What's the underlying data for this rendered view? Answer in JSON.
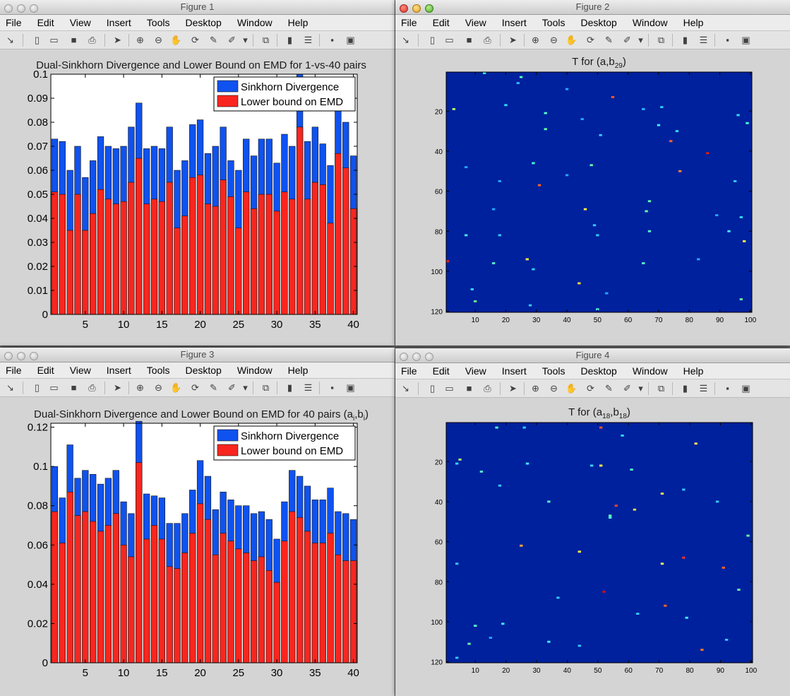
{
  "menu": [
    "File",
    "Edit",
    "View",
    "Insert",
    "Tools",
    "Desktop",
    "Window",
    "Help"
  ],
  "toolbar_icons": [
    {
      "name": "dock-arrow-icon",
      "glyph": "↘"
    },
    {
      "name": "new-figure-icon",
      "glyph": "▯"
    },
    {
      "name": "open-file-icon",
      "glyph": "▭"
    },
    {
      "name": "save-icon",
      "glyph": "■"
    },
    {
      "name": "print-icon",
      "glyph": "⎙"
    },
    {
      "name": "select-arrow-icon",
      "glyph": "➤"
    },
    {
      "name": "zoom-in-icon",
      "glyph": "⊕"
    },
    {
      "name": "zoom-out-icon",
      "glyph": "⊖"
    },
    {
      "name": "pan-hand-icon",
      "glyph": "✋"
    },
    {
      "name": "rotate-3d-icon",
      "glyph": "⟳"
    },
    {
      "name": "data-cursor-icon",
      "glyph": "✎"
    },
    {
      "name": "brush-icon",
      "glyph": "✐"
    },
    {
      "name": "brush-dropdown-icon",
      "glyph": "▾"
    },
    {
      "name": "link-plot-icon",
      "glyph": "⧉"
    },
    {
      "name": "colorbar-icon",
      "glyph": "▮"
    },
    {
      "name": "legend-icon",
      "glyph": "☰"
    },
    {
      "name": "hide-tools-icon",
      "glyph": "▪"
    },
    {
      "name": "show-tools-icon",
      "glyph": "▣"
    }
  ],
  "colors": {
    "sinkhorn": "#0f52ef",
    "emd": "#f8261f",
    "heat_bg": "#00219e",
    "plot_bg": "#ffffff"
  },
  "windows": [
    {
      "id": "figure1",
      "title": "Figure 1",
      "focused": false
    },
    {
      "id": "figure2",
      "title": "Figure 2",
      "focused": true
    },
    {
      "id": "figure3",
      "title": "Figure 3",
      "focused": false
    },
    {
      "id": "figure4",
      "title": "Figure 4",
      "focused": false
    }
  ],
  "chart_data": [
    {
      "figure": "Figure 1",
      "type": "bar",
      "stacked": true,
      "title": "Dual-Sinkhorn Divergence and Lower Bound on EMD for 1-vs-40 pairs",
      "xlim": [
        0.5,
        40.5
      ],
      "ylim": [
        0,
        0.1
      ],
      "xticks": [
        5,
        10,
        15,
        20,
        25,
        30,
        35,
        40
      ],
      "yticks": [
        0,
        0.01,
        0.02,
        0.03,
        0.04,
        0.05,
        0.06,
        0.07,
        0.08,
        0.09,
        0.1
      ],
      "ytick_labels": [
        "0",
        "0.01",
        "0.02",
        "0.03",
        "0.04",
        "0.05",
        "0.06",
        "0.07",
        "0.08",
        "0.09",
        "0.1"
      ],
      "legend": [
        "Sinkhorn Divergence",
        "Lower bound on EMD"
      ],
      "legend_position": "top-right",
      "series": [
        {
          "name": "Sinkhorn Divergence",
          "values": [
            0.073,
            0.072,
            0.06,
            0.07,
            0.057,
            0.064,
            0.074,
            0.07,
            0.069,
            0.07,
            0.078,
            0.088,
            0.069,
            0.07,
            0.069,
            0.078,
            0.06,
            0.064,
            0.079,
            0.081,
            0.067,
            0.07,
            0.078,
            0.064,
            0.06,
            0.073,
            0.066,
            0.073,
            0.073,
            0.063,
            0.075,
            0.07,
            0.1,
            0.072,
            0.078,
            0.071,
            0.062,
            0.089,
            0.08,
            0.066
          ]
        },
        {
          "name": "Lower bound on EMD",
          "values": [
            0.051,
            0.05,
            0.035,
            0.05,
            0.035,
            0.042,
            0.052,
            0.048,
            0.046,
            0.047,
            0.055,
            0.065,
            0.046,
            0.048,
            0.047,
            0.055,
            0.036,
            0.041,
            0.057,
            0.058,
            0.046,
            0.045,
            0.056,
            0.049,
            0.036,
            0.051,
            0.044,
            0.05,
            0.05,
            0.043,
            0.051,
            0.048,
            0.078,
            0.048,
            0.055,
            0.054,
            0.038,
            0.067,
            0.061,
            0.044
          ]
        }
      ]
    },
    {
      "figure": "Figure 2",
      "type": "heatmap",
      "title": "T for (a,b",
      "title_sub": "29",
      "title_end": ")",
      "xlim": [
        0.5,
        100.5
      ],
      "ylim": [
        0.5,
        120.5
      ],
      "xticks": [
        10,
        20,
        30,
        40,
        50,
        60,
        70,
        80,
        90,
        100
      ],
      "yticks": [
        20,
        40,
        60,
        80,
        100,
        120
      ],
      "points": [
        [
          13,
          1,
          "#3cffd0"
        ],
        [
          25,
          3,
          "#55ffb8"
        ],
        [
          24,
          6,
          "#33bbff"
        ],
        [
          40,
          9,
          "#22aaff"
        ],
        [
          55,
          13,
          "#ff5522"
        ],
        [
          3,
          19,
          "#aaff66"
        ],
        [
          20,
          17,
          "#33ddff"
        ],
        [
          33,
          21,
          "#55ffcc"
        ],
        [
          65,
          19,
          "#22bbff"
        ],
        [
          71,
          18,
          "#33ccff"
        ],
        [
          45,
          24,
          "#22aaff"
        ],
        [
          33,
          29,
          "#66ffaa"
        ],
        [
          51,
          32,
          "#33ccff"
        ],
        [
          70,
          27,
          "#44eeff"
        ],
        [
          76,
          30,
          "#33ddff"
        ],
        [
          96,
          22,
          "#33ddff"
        ],
        [
          99,
          26,
          "#44ffdd"
        ],
        [
          74,
          35,
          "#ff6622"
        ],
        [
          86,
          41,
          "#dd2211"
        ],
        [
          48,
          47,
          "#66ffaa"
        ],
        [
          29,
          46,
          "#44ffdd"
        ],
        [
          7,
          48,
          "#22aaff"
        ],
        [
          40,
          52,
          "#22aaff"
        ],
        [
          77,
          50,
          "#ff8833"
        ],
        [
          31,
          57,
          "#ff6622"
        ],
        [
          18,
          55,
          "#22aaff"
        ],
        [
          95,
          55,
          "#33ccff"
        ],
        [
          46,
          69,
          "#ffee44"
        ],
        [
          66,
          70,
          "#66ffaa"
        ],
        [
          16,
          69,
          "#22aaff"
        ],
        [
          67,
          65,
          "#66ffaa"
        ],
        [
          89,
          72,
          "#22aaff"
        ],
        [
          97,
          73,
          "#33ddff"
        ],
        [
          49,
          77,
          "#33ccff"
        ],
        [
          67,
          80,
          "#55ffcc"
        ],
        [
          7,
          82,
          "#44eeff"
        ],
        [
          50,
          82,
          "#33ccff"
        ],
        [
          18,
          82,
          "#33ccff"
        ],
        [
          93,
          80,
          "#44eeff"
        ],
        [
          98,
          85,
          "#ffee44"
        ],
        [
          27,
          94,
          "#ffee44"
        ],
        [
          1,
          95,
          "#ff2211"
        ],
        [
          29,
          99,
          "#33ccff"
        ],
        [
          16,
          96,
          "#55ffcc"
        ],
        [
          44,
          106,
          "#ffdd33"
        ],
        [
          9,
          109,
          "#33ddff"
        ],
        [
          53,
          111,
          "#22aaff"
        ],
        [
          10,
          115,
          "#66ff88"
        ],
        [
          28,
          117,
          "#33ccff"
        ],
        [
          50,
          119,
          "#55ffdd"
        ],
        [
          65,
          96,
          "#55ffcc"
        ],
        [
          83,
          94,
          "#22aaff"
        ],
        [
          97,
          114,
          "#66ffaa"
        ]
      ]
    },
    {
      "figure": "Figure 3",
      "type": "bar",
      "stacked": true,
      "title": "Dual-Sinkhorn Divergence and Lower Bound on EMD for 40 pairs (a",
      "title_sub1": "i",
      "title_mid": ",b",
      "title_sub2": "i",
      "title_end": ")",
      "xlim": [
        0.5,
        40.5
      ],
      "ylim": [
        0,
        0.122
      ],
      "xticks": [
        5,
        10,
        15,
        20,
        25,
        30,
        35,
        40
      ],
      "yticks": [
        0,
        0.02,
        0.04,
        0.06,
        0.08,
        0.1,
        0.12
      ],
      "ytick_labels": [
        "0",
        "0.02",
        "0.04",
        "0.06",
        "0.08",
        "0.1",
        "0.12"
      ],
      "legend": [
        "Sinkhorn Divergence",
        "Lower bound on EMD"
      ],
      "legend_position": "top-right",
      "series": [
        {
          "name": "Sinkhorn Divergence",
          "values": [
            0.1,
            0.084,
            0.111,
            0.094,
            0.098,
            0.096,
            0.091,
            0.094,
            0.098,
            0.082,
            0.076,
            0.123,
            0.086,
            0.085,
            0.084,
            0.071,
            0.071,
            0.076,
            0.088,
            0.103,
            0.095,
            0.078,
            0.087,
            0.083,
            0.08,
            0.08,
            0.076,
            0.077,
            0.073,
            0.063,
            0.082,
            0.098,
            0.095,
            0.09,
            0.083,
            0.083,
            0.089,
            0.077,
            0.076,
            0.073
          ]
        },
        {
          "name": "Lower bound on EMD",
          "values": [
            0.077,
            0.061,
            0.087,
            0.075,
            0.077,
            0.072,
            0.067,
            0.07,
            0.076,
            0.06,
            0.054,
            0.102,
            0.063,
            0.07,
            0.063,
            0.049,
            0.048,
            0.056,
            0.066,
            0.081,
            0.073,
            0.055,
            0.066,
            0.062,
            0.058,
            0.056,
            0.052,
            0.054,
            0.047,
            0.041,
            0.062,
            0.077,
            0.074,
            0.067,
            0.061,
            0.061,
            0.066,
            0.055,
            0.052,
            0.052
          ]
        }
      ]
    },
    {
      "figure": "Figure 4",
      "type": "heatmap",
      "title": "T for (a",
      "title_sub1": "18",
      "title_mid": ",b",
      "title_sub2": "18",
      "title_end": ")",
      "xlim": [
        0.5,
        100.5
      ],
      "ylim": [
        0.5,
        120.5
      ],
      "xticks": [
        10,
        20,
        30,
        40,
        50,
        60,
        70,
        80,
        90,
        100
      ],
      "yticks": [
        20,
        40,
        60,
        80,
        100,
        120
      ],
      "points": [
        [
          17,
          3,
          "#55ffcc"
        ],
        [
          26,
          3,
          "#33ccff"
        ],
        [
          51,
          3,
          "#ff5522"
        ],
        [
          58,
          7,
          "#33ddff"
        ],
        [
          82,
          11,
          "#ffee44"
        ],
        [
          5,
          19,
          "#aaff66"
        ],
        [
          4,
          21,
          "#33ddff"
        ],
        [
          27,
          21,
          "#44eeff"
        ],
        [
          48,
          22,
          "#33ddff"
        ],
        [
          51,
          22,
          "#ffff44"
        ],
        [
          61,
          24,
          "#55ffcc"
        ],
        [
          12,
          25,
          "#55ffcc"
        ],
        [
          18,
          32,
          "#33ccff"
        ],
        [
          71,
          36,
          "#ffee44"
        ],
        [
          78,
          34,
          "#33ccff"
        ],
        [
          34,
          40,
          "#55ffcc"
        ],
        [
          56,
          42,
          "#ff4422"
        ],
        [
          62,
          44,
          "#ffdd33"
        ],
        [
          89,
          40,
          "#33ccff"
        ],
        [
          54,
          47,
          "#66ffaa"
        ],
        [
          54,
          48,
          "#44ffdd"
        ],
        [
          25,
          62,
          "#ffaa33"
        ],
        [
          44,
          65,
          "#ffee44"
        ],
        [
          78,
          68,
          "#ff3322"
        ],
        [
          99,
          57,
          "#66ffaa"
        ],
        [
          71,
          71,
          "#ffff55"
        ],
        [
          91,
          73,
          "#ff6622"
        ],
        [
          4,
          71,
          "#33ccff"
        ],
        [
          52,
          85,
          "#cc1111"
        ],
        [
          72,
          92,
          "#ff6622"
        ],
        [
          79,
          98,
          "#44eeff"
        ],
        [
          96,
          84,
          "#66ffaa"
        ],
        [
          10,
          102,
          "#55ffcc"
        ],
        [
          19,
          101,
          "#44eeff"
        ],
        [
          84,
          114,
          "#ff7722"
        ],
        [
          44,
          112,
          "#33ccff"
        ],
        [
          8,
          111,
          "#66ffaa"
        ],
        [
          4,
          118,
          "#33ccff"
        ],
        [
          34,
          110,
          "#44eeff"
        ],
        [
          92,
          109,
          "#33ccff"
        ],
        [
          63,
          96,
          "#33ccff"
        ],
        [
          15,
          108,
          "#22aaff"
        ],
        [
          37,
          88,
          "#33ccff"
        ]
      ]
    }
  ]
}
